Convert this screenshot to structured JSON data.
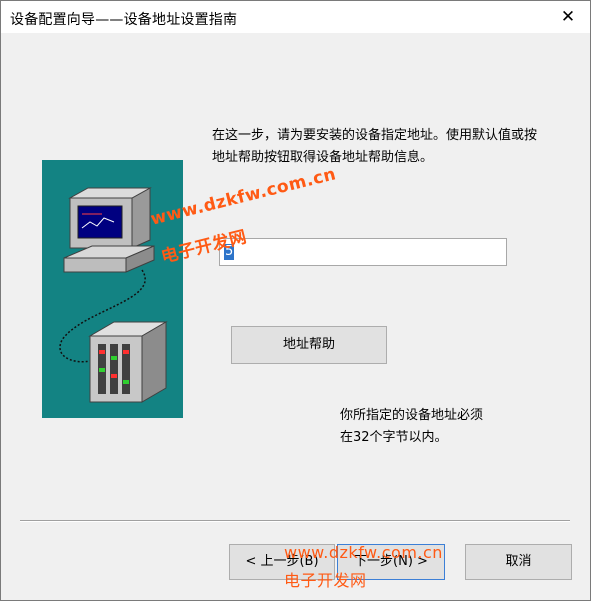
{
  "window": {
    "title": "设备配置向导——设备地址设置指南",
    "close_glyph": "✕"
  },
  "instruction": "在这一步，请为要安装的设备指定地址。使用默认值或按地址帮助按钮取得设备地址帮助信息。",
  "address_input": {
    "value": "5"
  },
  "help_button": {
    "label": "地址帮助"
  },
  "note": {
    "line1": "你所指定的设备地址必须",
    "line2": "在32个字节以内。"
  },
  "buttons": {
    "back": "< 上一步(B)",
    "next": "下一步(N) >",
    "cancel": "取消"
  },
  "watermark": {
    "url": "www.dzkfw.com.cn",
    "name": "电子开发网"
  },
  "colors": {
    "illustration_bg": "#138383",
    "watermark": "#ff5a14",
    "selection": "#2d74c9"
  }
}
